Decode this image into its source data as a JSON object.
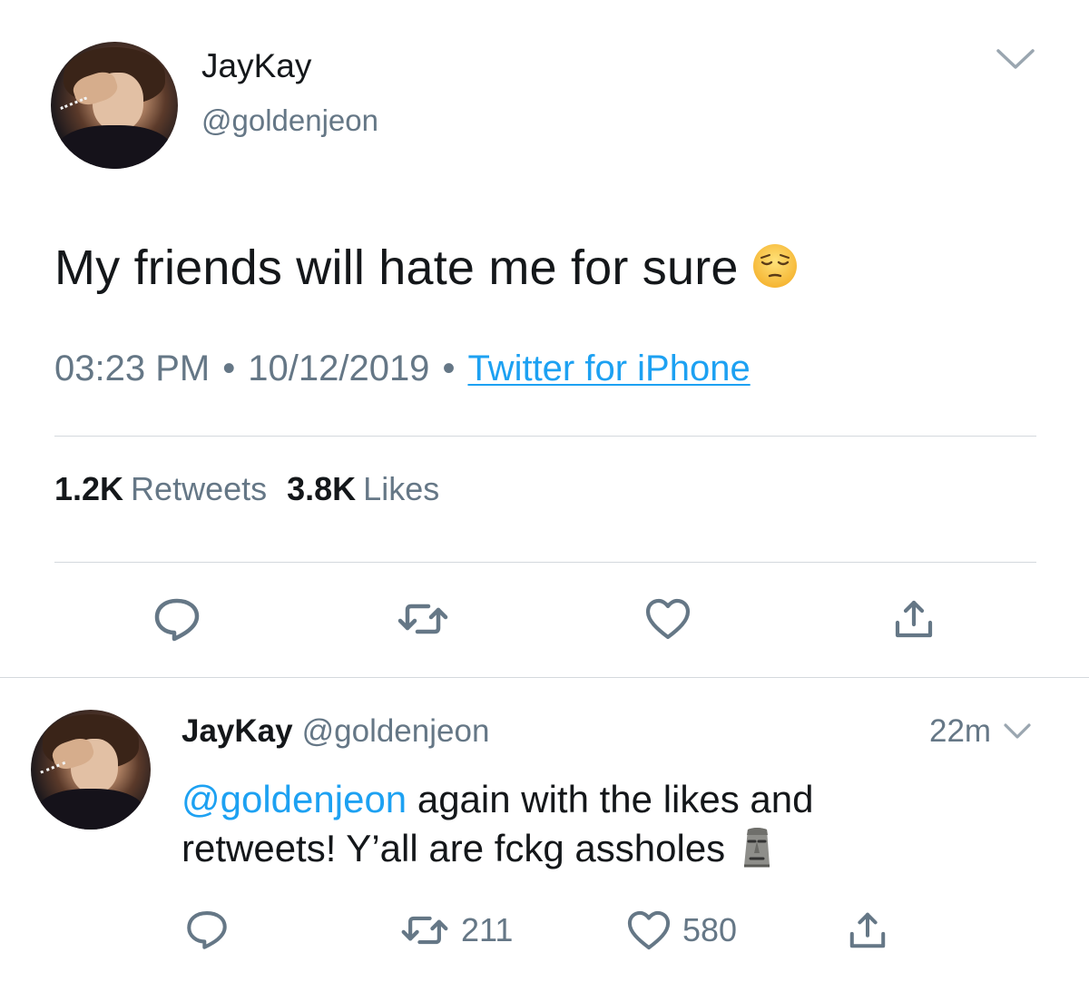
{
  "tweet": {
    "author_name": "JayKay",
    "author_handle": "@goldenjeon",
    "text": "My friends will hate me for sure",
    "text_emoji": "pensive-face",
    "time": "03:23 PM",
    "date": "10/12/2019",
    "separator": "•",
    "source": "Twitter for iPhone",
    "retweets_count": "1.2K",
    "retweets_label": "Retweets",
    "likes_count": "3.8K",
    "likes_label": "Likes",
    "actions": [
      "reply-icon",
      "retweet-icon",
      "like-icon",
      "share-icon"
    ]
  },
  "reply": {
    "author_name": "JayKay",
    "author_handle": "@goldenjeon",
    "time_ago": "22m",
    "mention": "@goldenjeon",
    "text_line1": " again with the likes and",
    "text_line2": "retweets! Y’all are fckg assholes",
    "text_emoji": "moai",
    "retweet_count": "211",
    "like_count": "580"
  },
  "colors": {
    "link_blue": "#1da1f2",
    "secondary_gray": "#657786",
    "icon_gray": "#657786",
    "divider": "#d4d9dd"
  }
}
